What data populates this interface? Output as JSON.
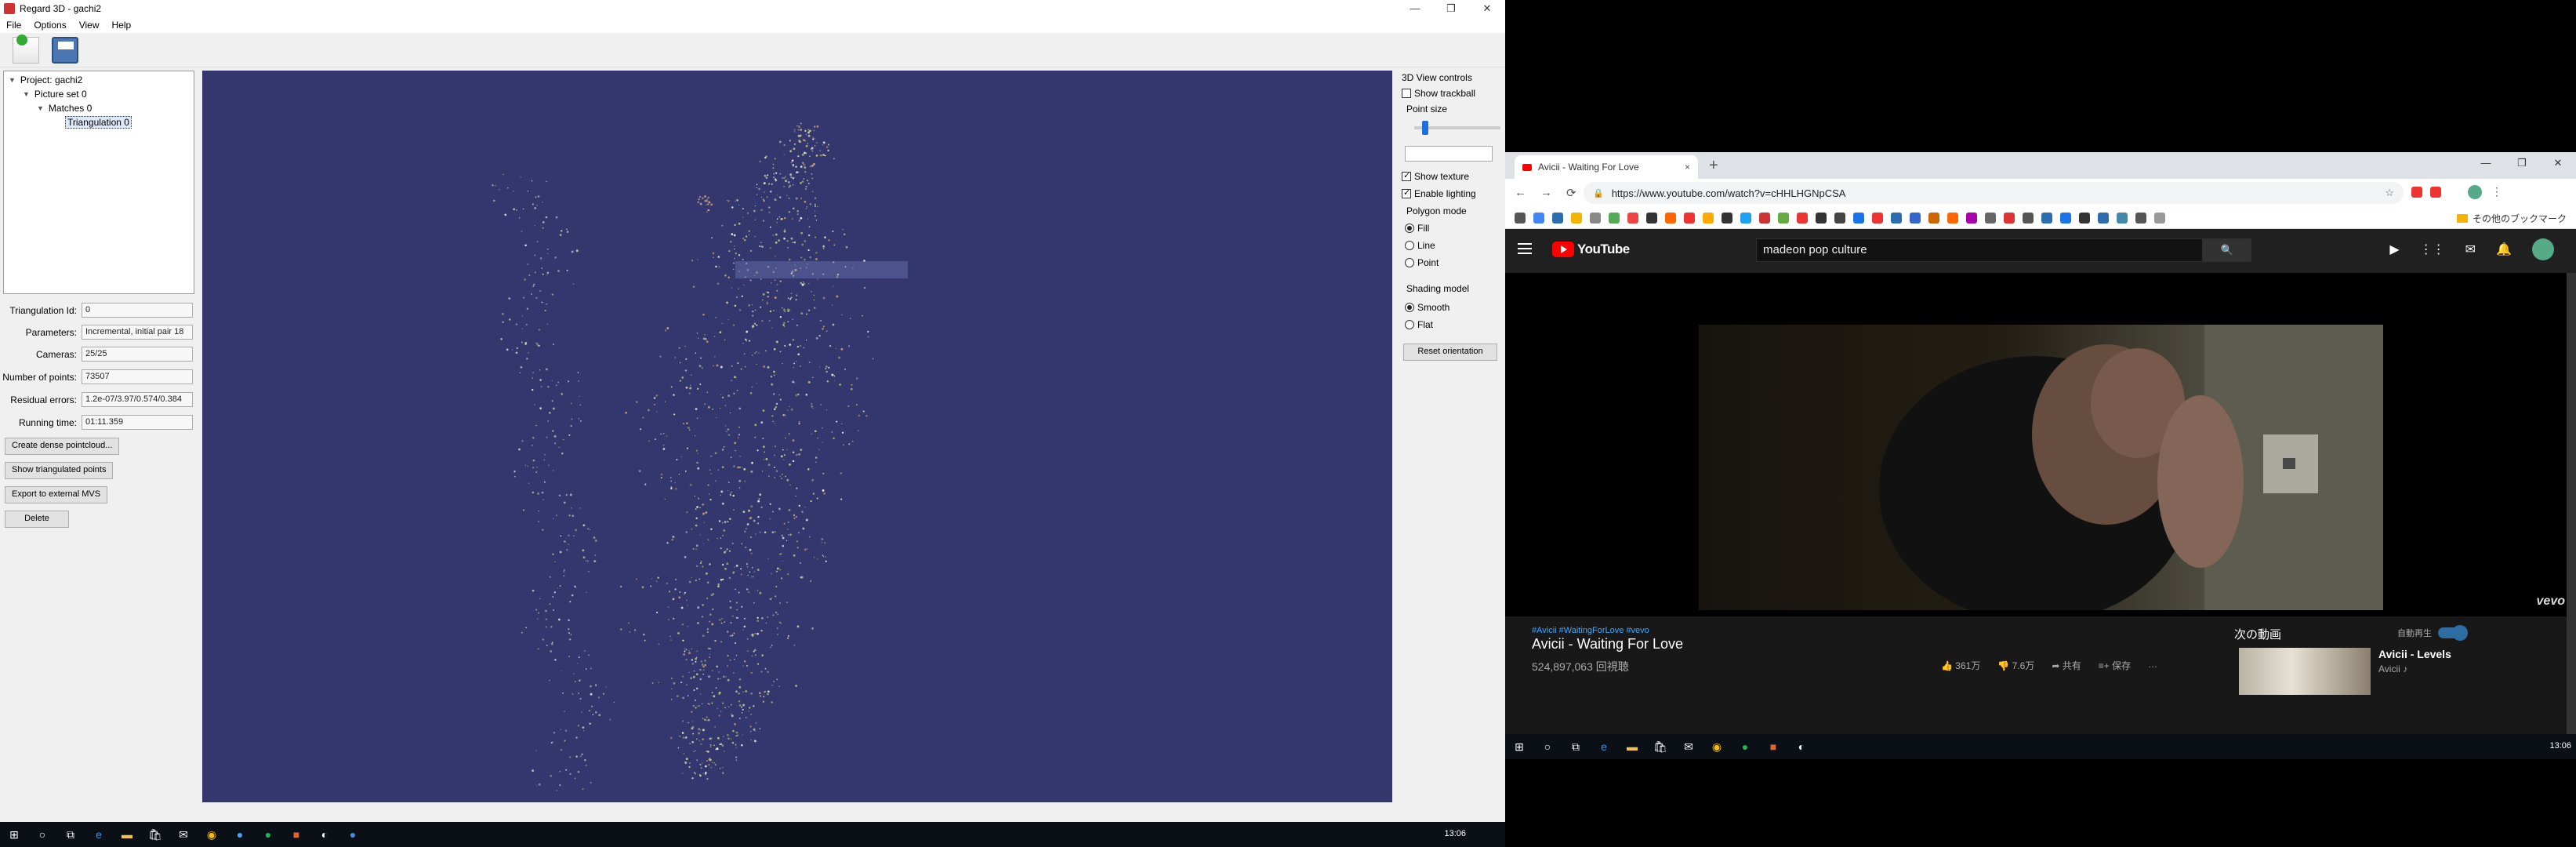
{
  "regard": {
    "window_title": "Regard 3D - gachi2",
    "window_buttons": [
      "—",
      "❐",
      "✕"
    ],
    "menu": [
      "File",
      "Options",
      "View",
      "Help"
    ],
    "tree": {
      "project": "Project: gachi2",
      "picture_set": "Picture set 0",
      "matches": "Matches 0",
      "triangulation": "Triangulation 0"
    },
    "properties": [
      {
        "label": "Triangulation Id:",
        "value": "0"
      },
      {
        "label": "Parameters:",
        "value": "Incremental, initial pair 18"
      },
      {
        "label": "Cameras:",
        "value": "25/25"
      },
      {
        "label": "Number of points:",
        "value": "73507"
      },
      {
        "label": "Residual errors:",
        "value": "1.2e-07/3.97/0.574/0.384"
      },
      {
        "label": "Running time:",
        "value": "01:11.359"
      }
    ],
    "buttons": {
      "create_dense": "Create dense pointcloud...",
      "show_triangulated": "Show triangulated points",
      "export": "Export to external MVS",
      "delete": "Delete"
    },
    "controls": {
      "header": "3D View controls",
      "show_trackball": "Show trackball",
      "point_size": "Point size",
      "show_texture": "Show texture",
      "enable_lighting": "Enable lighting",
      "polygon_mode": "Polygon mode",
      "polygon_options": [
        "Fill",
        "Line",
        "Point"
      ],
      "shading_model": "Shading model",
      "shading_options": [
        "Smooth",
        "Flat"
      ],
      "reset": "Reset orientation"
    },
    "colors": {
      "viewport_bg": "#34366e"
    }
  },
  "taskbar_left": {
    "clock": "13:06"
  },
  "chrome": {
    "tab_title": "Avicii - Waiting For Love",
    "tab_close": "×",
    "new_tab": "+",
    "window_buttons": [
      "—",
      "❐",
      "✕"
    ],
    "nav": [
      "←",
      "→",
      "⟳"
    ],
    "url": "https://www.youtube.com/watch?v=cHHLHGNpCSA",
    "other_bookmarks": "その他のブックマーク"
  },
  "youtube": {
    "logo": "YouTube",
    "search_value": "madeon pop culture",
    "search_icon": "🔍",
    "header_icons": [
      "video-camera-icon",
      "apps-grid-icon",
      "message-icon",
      "bell-icon"
    ],
    "header_glyphs": [
      "▶",
      "⋮⋮",
      "✉",
      "🔔"
    ],
    "tags": "#Avicii #WaitingForLove #vevo",
    "title": "Avicii - Waiting For Love",
    "views": "524,897,063 回視聴",
    "likes": "361万",
    "dislikes": "7.6万",
    "share": "共有",
    "save": "保存",
    "more": "…",
    "vevo": "vevo",
    "next_label": "次の動画",
    "autoplay": "自動再生",
    "next_title": "Avicii - Levels",
    "next_channel": "Avicii ♪"
  },
  "taskbar_right": {
    "clock": "13:06"
  }
}
